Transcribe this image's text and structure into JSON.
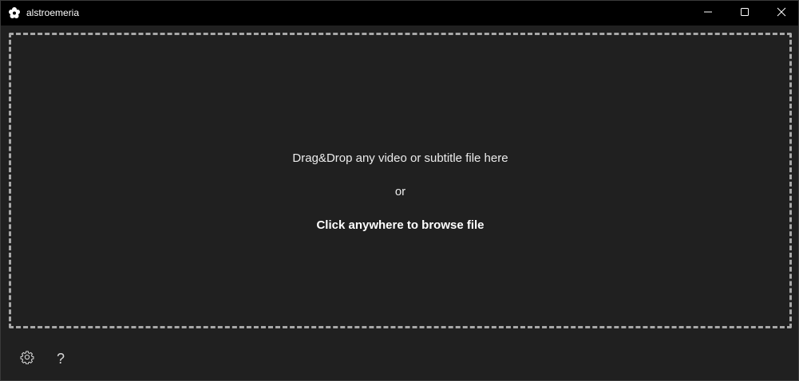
{
  "window": {
    "title": "alstroemeria",
    "app_icon": "flower-icon",
    "controls": {
      "minimize": "minimize-icon",
      "maximize": "maximize-icon",
      "close": "close-icon"
    }
  },
  "dropzone": {
    "instruction": "Drag&Drop any video or subtitle file here",
    "separator": "or",
    "action": "Click anywhere to browse file"
  },
  "footer": {
    "settings_icon": "gear-icon",
    "help_label": "?"
  },
  "colors": {
    "titlebar": "#000000",
    "background": "#202020",
    "dash_border": "#a8a8a8",
    "text": "#ffffff"
  }
}
